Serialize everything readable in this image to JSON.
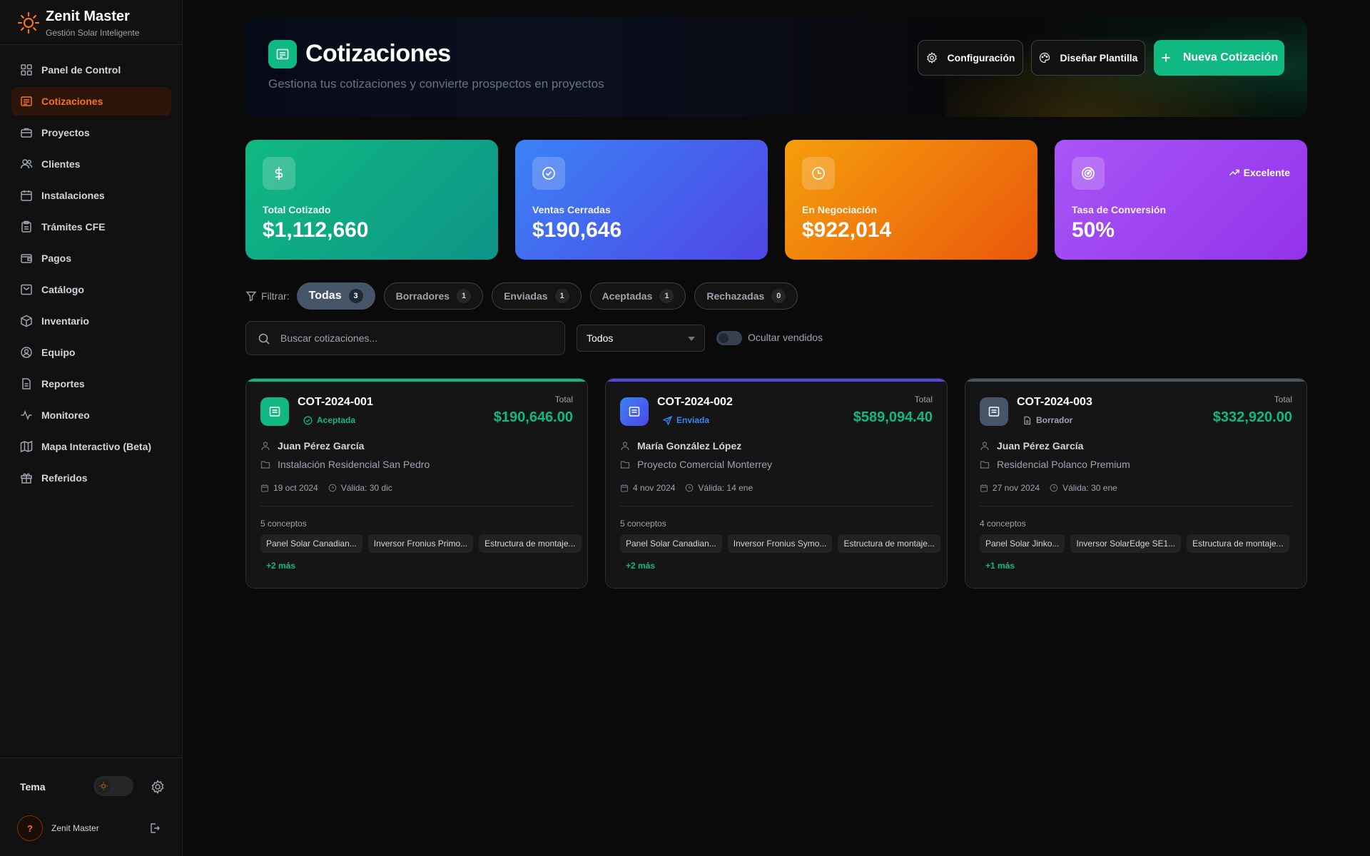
{
  "sidebar": {
    "brand_title": "Zenit Master",
    "brand_subtitle": "Gestión Solar Inteligente",
    "items": [
      {
        "label": "Panel de Control",
        "icon": "dashboard-icon"
      },
      {
        "label": "Cotizaciones",
        "icon": "quote-icon",
        "active": true
      },
      {
        "label": "Proyectos",
        "icon": "briefcase-icon"
      },
      {
        "label": "Clientes",
        "icon": "users-icon"
      },
      {
        "label": "Instalaciones",
        "icon": "calendar-icon"
      },
      {
        "label": "Trámites CFE",
        "icon": "clipboard-icon"
      },
      {
        "label": "Pagos",
        "icon": "wallet-icon"
      },
      {
        "label": "Catálogo",
        "icon": "catalog-icon"
      },
      {
        "label": "Inventario",
        "icon": "package-icon"
      },
      {
        "label": "Equipo",
        "icon": "user-circle-icon"
      },
      {
        "label": "Reportes",
        "icon": "file-icon"
      },
      {
        "label": "Monitoreo",
        "icon": "activity-icon"
      },
      {
        "label": "Mapa Interactivo (Beta)",
        "icon": "map-icon"
      },
      {
        "label": "Referidos",
        "icon": "gift-icon"
      }
    ],
    "theme_label": "Tema",
    "user_name": "Zenit Master",
    "avatar_initial": "?"
  },
  "header": {
    "title": "Cotizaciones",
    "subtitle": "Gestiona tus cotizaciones y convierte prospectos en proyectos",
    "btn_config": "Configuración",
    "btn_template": "Diseñar Plantilla",
    "btn_new": "Nueva Cotización"
  },
  "stats": [
    {
      "label": "Total Cotizado",
      "value": "$1,112,660",
      "icon": "dollar-icon",
      "gradient": [
        "#10b981",
        "#0d9488"
      ]
    },
    {
      "label": "Ventas Cerradas",
      "value": "$190,646",
      "icon": "check-circle-icon",
      "gradient": [
        "#3b82f6",
        "#4f46e5"
      ]
    },
    {
      "label": "En Negociación",
      "value": "$922,014",
      "icon": "clock-icon",
      "gradient": [
        "#f59e0b",
        "#ea580c"
      ]
    },
    {
      "label": "Tasa de Conversión",
      "value": "50%",
      "icon": "target-icon",
      "badge": "Excelente",
      "gradient": [
        "#a855f7",
        "#9333ea"
      ]
    }
  ],
  "filters": {
    "label": "Filtrar:",
    "chips": [
      {
        "label": "Todas",
        "count": "3",
        "active": true
      },
      {
        "label": "Borradores",
        "count": "1"
      },
      {
        "label": "Enviadas",
        "count": "1"
      },
      {
        "label": "Aceptadas",
        "count": "1"
      },
      {
        "label": "Rechazadas",
        "count": "0"
      }
    ],
    "search_placeholder": "Buscar cotizaciones...",
    "select_value": "Todos",
    "toggle_label": "Ocultar vendidos"
  },
  "quotes": [
    {
      "id": "COT-2024-001",
      "status": "Aceptada",
      "status_color": "#10b981",
      "accent": "#10b981",
      "icon_bg": "#10b981",
      "total_label": "Total",
      "total": "$190,646.00",
      "client": "Juan Pérez García",
      "project": "Instalación Residencial San Pedro",
      "date": "19 oct 2024",
      "valid": "Válida: 30 dic",
      "concepts": "5 conceptos",
      "tags": [
        "Panel Solar Canadian...",
        "Inversor Fronius Primo...",
        "Estructura de montaje..."
      ],
      "more": "+2 más"
    },
    {
      "id": "COT-2024-002",
      "status": "Enviada",
      "status_color": "#3b82f6",
      "accent": "#4f46e5",
      "icon_bg": "#4f46e5",
      "total_label": "Total",
      "total": "$589,094.40",
      "client": "María González López",
      "project": "Proyecto Comercial Monterrey",
      "date": "4 nov 2024",
      "valid": "Válida: 14 ene",
      "concepts": "5 conceptos",
      "tags": [
        "Panel Solar Canadian...",
        "Inversor Fronius Symo...",
        "Estructura de montaje..."
      ],
      "more": "+2 más"
    },
    {
      "id": "COT-2024-003",
      "status": "Borrador",
      "status_color": "#9ca3af",
      "accent": "#4b5563",
      "icon_bg": "#475569",
      "total_label": "Total",
      "total": "$332,920.00",
      "client": "Juan Pérez García",
      "project": "Residencial Polanco Premium",
      "date": "27 nov 2024",
      "valid": "Válida: 30 ene",
      "concepts": "4 conceptos",
      "tags": [
        "Panel Solar Jinko...",
        "Inversor SolarEdge SE1...",
        "Estructura de montaje..."
      ],
      "more": "+1 más"
    }
  ]
}
